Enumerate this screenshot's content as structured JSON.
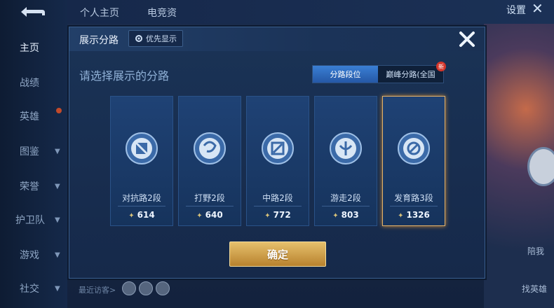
{
  "sidebar": {
    "items": [
      {
        "label": "主页"
      },
      {
        "label": "战绩"
      },
      {
        "label": "英雄"
      },
      {
        "label": "图鉴"
      },
      {
        "label": "荣誉"
      },
      {
        "label": "护卫队"
      },
      {
        "label": "游戏"
      },
      {
        "label": "社交"
      }
    ]
  },
  "topbar": {
    "tab1": "个人主页",
    "tab2": "电竞资",
    "settings": "设置",
    "close": "✕"
  },
  "background": {
    "visitors_label": "最近访客>",
    "right_label_1": "陪我",
    "right_label_2": "找英雄"
  },
  "modal": {
    "title": "展示分路",
    "priority_label": "优先显示",
    "subtitle": "请选择展示的分路",
    "tabs": [
      {
        "label": "分路段位",
        "active": true
      },
      {
        "label": "巅峰分路(全国",
        "active": false,
        "badge": "新"
      }
    ],
    "cards": [
      {
        "name": "对抗路2段",
        "score": "614",
        "icon": "clash-lane-icon",
        "selected": false
      },
      {
        "name": "打野2段",
        "score": "640",
        "icon": "jungle-icon",
        "selected": false
      },
      {
        "name": "中路2段",
        "score": "772",
        "icon": "mid-lane-icon",
        "selected": false
      },
      {
        "name": "游走2段",
        "score": "803",
        "icon": "roam-icon",
        "selected": false
      },
      {
        "name": "发育路3段",
        "score": "1326",
        "icon": "farm-lane-icon",
        "selected": true
      }
    ],
    "confirm_label": "确定"
  },
  "colors": {
    "accent_blue": "#3a7fd4",
    "gold_button": "#d9a84c",
    "selected_border": "#e2b26a",
    "panel_bg": "#1a3356"
  }
}
